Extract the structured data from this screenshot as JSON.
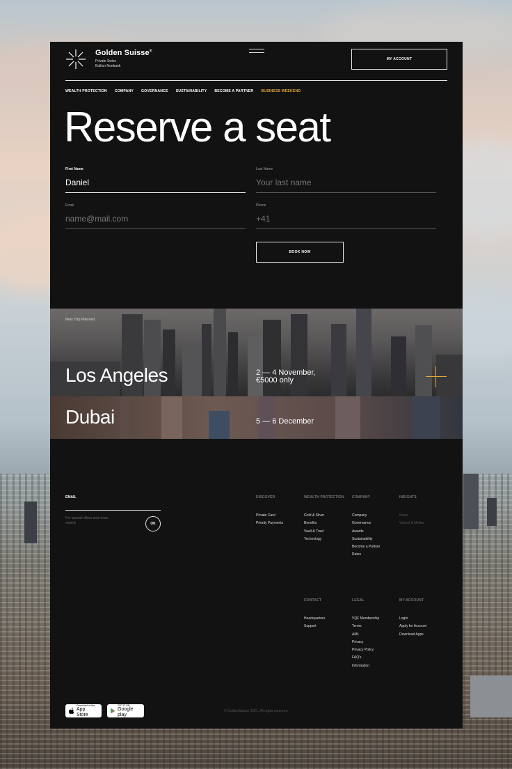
{
  "brand": {
    "name": "Golden Suisse",
    "trademark": "®",
    "tagline_line1": "Private Swiss",
    "tagline_line2": "Bullion Nonbank"
  },
  "header": {
    "account_label": "MY ACCOUNT"
  },
  "nav": [
    {
      "label": "WEALTH PROTECTION"
    },
    {
      "label": "COMPANY"
    },
    {
      "label": "GOVERNANCE"
    },
    {
      "label": "SUSTAINABILITY"
    },
    {
      "label": "BECOME A PARTNER"
    },
    {
      "label": "BUSINESS WEEKEND",
      "accent": true
    }
  ],
  "title": "Reserve a seat",
  "form": {
    "first_name": {
      "label": "First Name",
      "value": "Daniel"
    },
    "last_name": {
      "label": "Last Name",
      "placeholder": "Your last name"
    },
    "email": {
      "label": "Email",
      "placeholder": "name@mail.com"
    },
    "phone": {
      "label": "Phone",
      "placeholder": "+41"
    },
    "submit_label": "BOOK NOW"
  },
  "trips": {
    "label": "Next Trip Planned",
    "items": [
      {
        "city": "Los Angeles",
        "date_line1": "2 — 4 November,",
        "date_line2": "€5000 only"
      },
      {
        "city": "Dubai",
        "date_line1": "5 — 6 December"
      }
    ]
  },
  "footer": {
    "email_label": "EMAIL",
    "email_note": "For special offers and news weekly",
    "ok_label": "OK",
    "columns": {
      "discover": {
        "title": "DISCOVER",
        "links": [
          "Private Card",
          "Priority Payments"
        ]
      },
      "wealth": {
        "title": "WEALTH PROTECTION",
        "links": [
          "Gold & Silver",
          "Benefits",
          "Vault & Trust",
          "Technology"
        ]
      },
      "company": {
        "title": "COMPANY",
        "links": [
          "Company",
          "Governance",
          "Awards",
          "Sustainability",
          "Become a Partner",
          "Rates"
        ]
      },
      "insights": {
        "title": "INSIGHTS",
        "links": [
          "News",
          "Videos & Media"
        ]
      },
      "contact": {
        "title": "CONTACT",
        "links": [
          "Headquarters",
          "Support"
        ]
      },
      "legal": {
        "title": "LEGAL",
        "links": [
          "VQF Membership",
          "Terms",
          "AML",
          "Privacy",
          "Privacy Policy",
          "FAQ's",
          "Information"
        ]
      },
      "myaccount": {
        "title": "MY ACCOUNT",
        "links": [
          "Login",
          "Apply for Account",
          "Download Apps"
        ]
      }
    },
    "app_store": {
      "small": "Download on the",
      "big": "App Store"
    },
    "google_play": {
      "small": "GET IT ON",
      "big": "Google play"
    },
    "copyright": "© GoldenSuisse 2021. All rights reserved."
  },
  "colors": {
    "page_bg": "#121212",
    "accent": "#e3a73c",
    "text": "#ffffff"
  }
}
